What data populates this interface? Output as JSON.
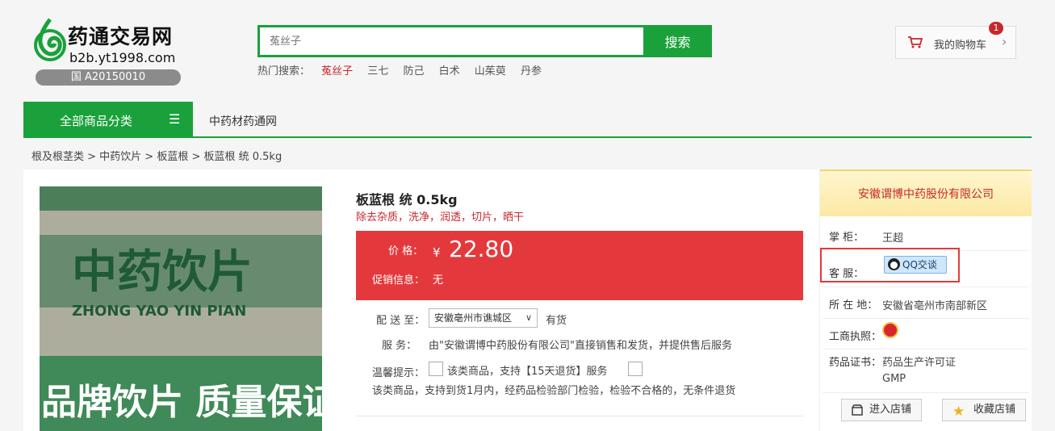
{
  "header": {
    "logo_title": "药通交易网",
    "logo_url": "b2b.yt1998.com",
    "logo_badge": "国 A20150010",
    "search_placeholder": "菟丝子",
    "search_button": "搜索",
    "hot_label": "热门搜索：",
    "hot_items": [
      "菟丝子",
      "三七",
      "防己",
      "白术",
      "山茱萸",
      "丹参"
    ],
    "cart_label": "我的购物车",
    "cart_count": "1",
    "cart_icon": "cart-icon",
    "brand_color": "#1aa13b"
  },
  "nav": {
    "all_categories": "全部商品分类",
    "link": "中药材药通网"
  },
  "breadcrumb": "根及根茎类 > 中药饮片 > 板蓝根  >  板蓝根 统 0.5kg",
  "product": {
    "title": "板蓝根 统 0.5kg",
    "subtitle": "除去杂质，洗净，润透，切片，晒干",
    "price_label": "价    格：",
    "price_symbol": "¥",
    "price": "22.80",
    "promo_label": "促销信息：",
    "promo_value": "无",
    "ship_label": "配 送 至：",
    "ship_value": "安徽亳州市谯城区",
    "stock": "有货",
    "service_label": "服      务：",
    "service_value": "由\"安徽谓博中药股份有限公司\"直接销售和发货，并提供售后服务",
    "tip_label": "温馨提示：",
    "tip_value1": "该类商品，支持【15天退货】服务",
    "tip_value2": "该类商品，支持到货1月内，经药品检验部门检验，检验不合格的，无条件退货",
    "accent_color": "#e4393c"
  },
  "shop": {
    "name": "安徽谓博中药股份有限公司",
    "manager_label": "掌      柜：",
    "manager_value": "王超",
    "service_label": "客      服：",
    "qq_button": "QQ交谈",
    "location_label": "所 在 地：",
    "location_value": "安徽省亳州市南部新区",
    "license_label": "工商执照：",
    "cert_label": "药品证书：",
    "cert_value1": "药品生产许可证",
    "cert_value2": "GMP",
    "enter_button": "进入店铺",
    "fav_button": "收藏店铺"
  }
}
